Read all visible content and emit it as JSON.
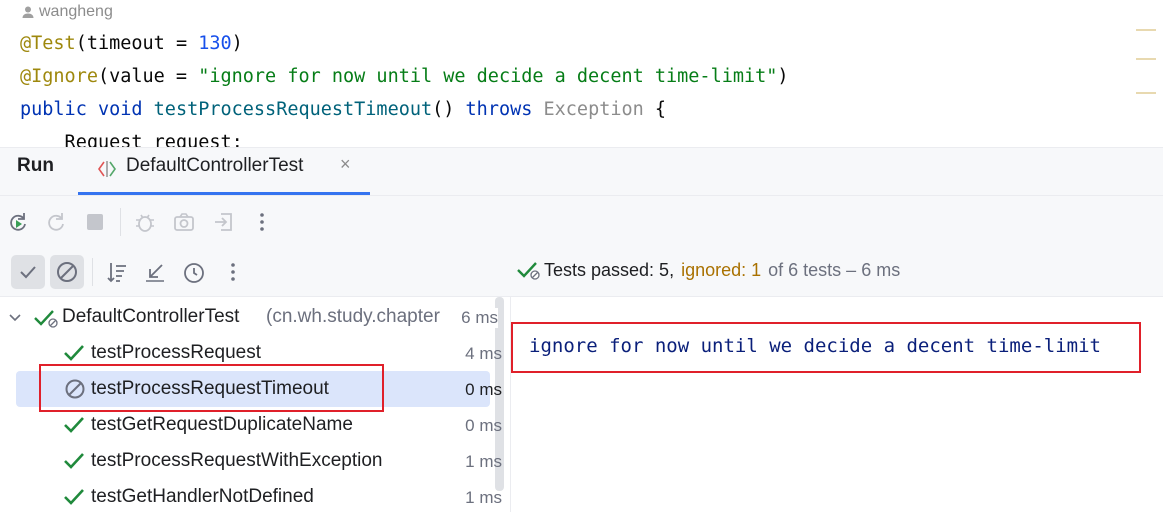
{
  "editor": {
    "author": "wangheng",
    "line1": {
      "annotation": "@Test",
      "paren_open": "(timeout = ",
      "value": "130",
      "paren_close": ")"
    },
    "line2": {
      "annotation": "@Ignore",
      "paren_open": "(value = ",
      "value": "\"ignore for now until we decide a decent time-limit\"",
      "paren_close": ")"
    },
    "line3": {
      "kw1": "public",
      "kw2": "void",
      "method": "testProcessRequestTimeout",
      "parens": "() ",
      "throws": "throws",
      "type": "Exception",
      "brace": " {"
    },
    "line4": "    Request request;"
  },
  "run_panel": {
    "title": "Run",
    "tab_label": "DefaultControllerTest",
    "tab_close": "×"
  },
  "toolbar1": {
    "icons": [
      "rerun-icon",
      "rerun-failed-icon",
      "stop-icon",
      "debug-icon",
      "camera-icon",
      "exit-icon",
      "more-icon"
    ]
  },
  "toolbar2": {
    "icons": [
      "show-passed-icon",
      "show-ignored-icon",
      "sort-icon",
      "collapse-icon",
      "history-icon",
      "more-icon"
    ]
  },
  "status": {
    "passed_label": "Tests passed: 5,",
    "ignored_label": "ignored: 1",
    "rest": "of 6 tests – 6 ms"
  },
  "tree": {
    "root": {
      "name": "DefaultControllerTest",
      "package": "(cn.wh.study.chapter",
      "time": "6 ms"
    },
    "tests": [
      {
        "name": "testProcessRequest",
        "time": "4 ms",
        "status": "passed"
      },
      {
        "name": "testProcessRequestTimeout",
        "time": "0 ms",
        "status": "ignored"
      },
      {
        "name": "testGetRequestDuplicateName",
        "time": "0 ms",
        "status": "passed"
      },
      {
        "name": "testProcessRequestWithException",
        "time": "1 ms",
        "status": "passed"
      },
      {
        "name": "testGetHandlerNotDefined",
        "time": "1 ms",
        "status": "passed"
      }
    ]
  },
  "output": {
    "text": "ignore for now until we decide a decent time-limit"
  },
  "colors": {
    "accent": "#3574f0",
    "passed": "#208a3c",
    "ignored": "#a97100",
    "highlight_box": "#e0202a",
    "selected_row": "#dbe5fb"
  }
}
